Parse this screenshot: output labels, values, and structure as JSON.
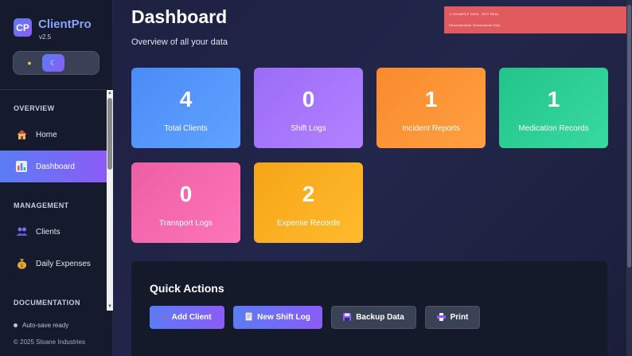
{
  "app": {
    "name": "ClientPro",
    "logo_text": "CP",
    "version": "v2.5"
  },
  "theme_toggle": {
    "light_icon": "sun-icon",
    "dark_icon": "moon-icon",
    "active": "dark"
  },
  "nav": {
    "sections": [
      {
        "title": "OVERVIEW",
        "items": [
          {
            "label": "Home",
            "icon": "house-icon",
            "active": false
          },
          {
            "label": "Dashboard",
            "icon": "bar-chart-icon",
            "active": true
          }
        ]
      },
      {
        "title": "MANAGEMENT",
        "items": [
          {
            "label": "Clients",
            "icon": "people-icon",
            "active": false
          },
          {
            "label": "Daily Expenses",
            "icon": "money-bag-icon",
            "active": false
          }
        ]
      },
      {
        "title": "DOCUMENTATION",
        "items": []
      }
    ]
  },
  "footer": {
    "status": "Auto-save ready",
    "copyright": "© 2025 Sloane Industries"
  },
  "header": {
    "title": "Dashboard",
    "subtitle": "Overview of all your data"
  },
  "banner": {
    "line1": "⚠ EXAMPLE DATA - NOT REAL",
    "line2": "Demonstration Screenshots Only"
  },
  "stats": [
    {
      "value": "4",
      "label": "Total Clients",
      "color": "#4a8cf7"
    },
    {
      "value": "0",
      "label": "Shift Logs",
      "color": "#9b6cf7"
    },
    {
      "value": "1",
      "label": "Incident Reports",
      "color": "#f98a2c"
    },
    {
      "value": "1",
      "label": "Medication Records",
      "color": "#22c48a"
    },
    {
      "value": "0",
      "label": "Transport Logs",
      "color": "#ec5fa4"
    },
    {
      "value": "2",
      "label": "Expense Records",
      "color": "#f5a517"
    }
  ],
  "quick_actions": {
    "title": "Quick Actions",
    "buttons": [
      {
        "label": "Add Client",
        "icon": "plus-icon",
        "style": "primary"
      },
      {
        "label": "New Shift Log",
        "icon": "document-icon",
        "style": "primary"
      },
      {
        "label": "Backup Data",
        "icon": "floppy-disk-icon",
        "style": "secondary"
      },
      {
        "label": "Print",
        "icon": "printer-icon",
        "style": "secondary"
      }
    ]
  }
}
